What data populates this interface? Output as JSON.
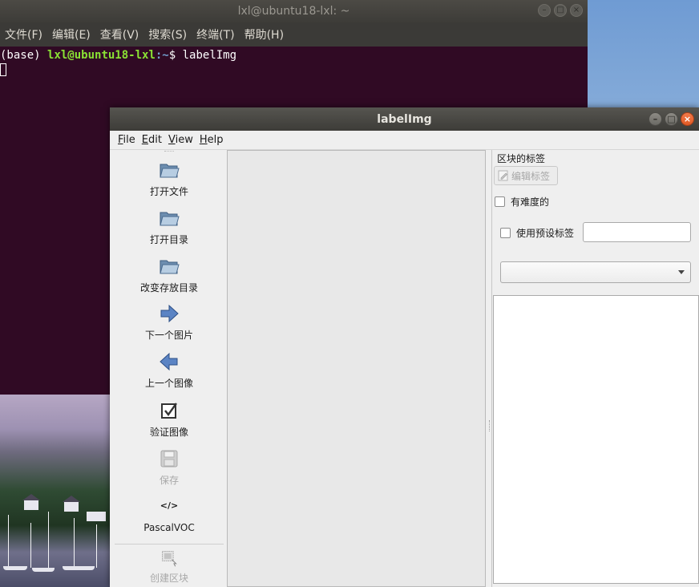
{
  "terminal": {
    "title": "lxl@ubuntu18-lxl: ~",
    "menu": [
      "文件(F)",
      "编辑(E)",
      "查看(V)",
      "搜索(S)",
      "终端(T)",
      "帮助(H)"
    ],
    "prompt_env": "(base)",
    "prompt_user": "lxl@ubuntu18-lxl",
    "prompt_path": ":~",
    "prompt_symbol": "$",
    "command": "labelImg"
  },
  "window_controls": {
    "minimize": "–",
    "maximize": "□",
    "close": "×"
  },
  "labelimg": {
    "title": "labelImg",
    "menu": [
      {
        "u": "F",
        "rest": "ile"
      },
      {
        "u": "E",
        "rest": "dit"
      },
      {
        "u": "V",
        "rest": "iew"
      },
      {
        "u": "H",
        "rest": "elp"
      }
    ],
    "tools": {
      "open_file": "打开文件",
      "open_dir": "打开目录",
      "change_save_dir": "改变存放目录",
      "next_image": "下一个图片",
      "prev_image": "上一个图像",
      "verify_image": "验证图像",
      "save": "保存",
      "format_icon_text": "</>",
      "format": "PascalVOC",
      "create_box": "创建区块"
    },
    "dock": {
      "title": "区块的标签",
      "edit_label": "编辑标签",
      "difficult": "有难度的",
      "use_default_label": "使用预设标签",
      "default_label_value": "",
      "combo_value": ""
    }
  },
  "colors": {
    "terminal_bg": "#300a24",
    "prompt_user": "#8ae234",
    "prompt_path": "#729fcf",
    "close_button": "#e05a25"
  }
}
